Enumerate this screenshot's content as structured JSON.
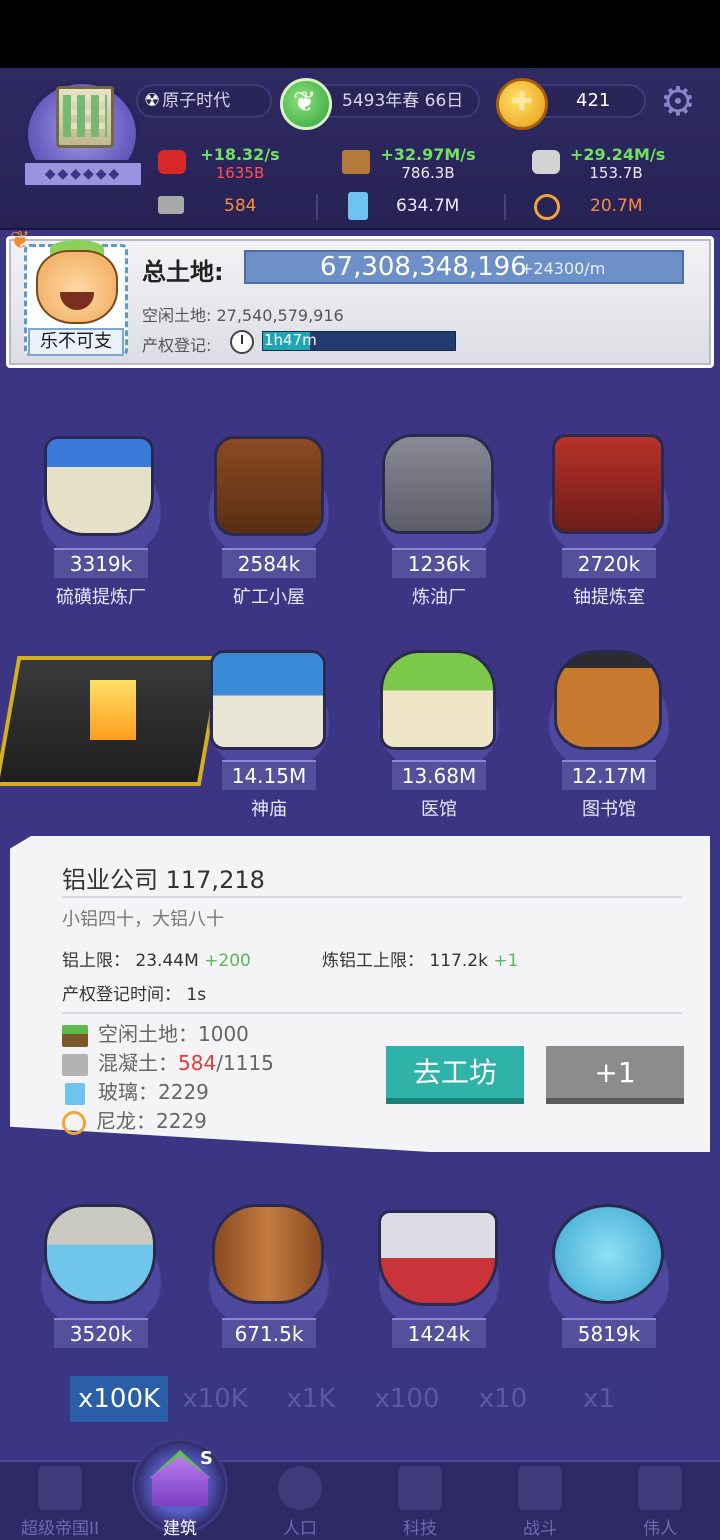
{
  "hud": {
    "era": "原子时代",
    "date": "5493年春 66日",
    "gold": "421",
    "resources": [
      {
        "name": "food",
        "rate": "+18.32/s",
        "total": "1635B",
        "color": "#ff5050"
      },
      {
        "name": "wood",
        "rate": "+32.97M/s",
        "total": "786.3B",
        "color": "#ece9ff"
      },
      {
        "name": "stone",
        "rate": "+29.24M/s",
        "total": "153.7B",
        "color": "#ece9ff"
      }
    ],
    "materials": [
      {
        "name": "concrete",
        "value": "584",
        "color": "#ff8a3d"
      },
      {
        "name": "glass",
        "value": "634.7M",
        "color": "#ece9ff"
      },
      {
        "name": "nylon",
        "value": "20.7M",
        "color": "#ff8a3d"
      }
    ]
  },
  "land": {
    "player_name": "乐不可支",
    "total_label": "总土地:",
    "total": "67,308,348,196",
    "rate": "+24300/m",
    "idle": "空闲土地: 27,540,579,916",
    "register_label": "产权登记:",
    "register_time": "1h47m",
    "register_progress": 0.24
  },
  "buildings_row1": [
    {
      "count": "3319k",
      "name": "硫磺提炼厂"
    },
    {
      "count": "2584k",
      "name": "矿工小屋"
    },
    {
      "count": "1236k",
      "name": "炼油厂"
    },
    {
      "count": "2720k",
      "name": "铀提炼室"
    }
  ],
  "buildings_row2": [
    {
      "count": "14.15M",
      "name": "神庙"
    },
    {
      "count": "13.68M",
      "name": "医馆"
    },
    {
      "count": "12.17M",
      "name": "图书馆"
    }
  ],
  "info": {
    "title": "铝业公司 117,218",
    "subtitle": "小铝四十，大铝八十",
    "cap_label": "铝上限：",
    "cap_value": "23.44M",
    "cap_bonus": "+200",
    "worker_label": "炼铝工上限：",
    "worker_value": "117.2k",
    "worker_bonus": "+1",
    "reg_label": "产权登记时间：",
    "reg_value": "1s",
    "costs": [
      {
        "label": "空闲土地：",
        "have": "1000",
        "need": ""
      },
      {
        "label": "混凝土：",
        "have": "584",
        "need": "/1115"
      },
      {
        "label": "玻璃：",
        "have": "2229",
        "need": ""
      },
      {
        "label": "尼龙：",
        "have": "2229",
        "need": ""
      }
    ],
    "go_button": "去工坊",
    "plus_button": "+1"
  },
  "buildings_row3": [
    {
      "count": "3520k"
    },
    {
      "count": "671.5k"
    },
    {
      "count": "1424k"
    },
    {
      "count": "5819k"
    }
  ],
  "multipliers": [
    "x100K",
    "x10K",
    "x1K",
    "x100",
    "x10",
    "x1"
  ],
  "nav": [
    {
      "label": "超级帝国II"
    },
    {
      "label": "建筑"
    },
    {
      "label": "人口"
    },
    {
      "label": "科技"
    },
    {
      "label": "战斗"
    },
    {
      "label": "伟人"
    }
  ],
  "nav_badge": "S"
}
